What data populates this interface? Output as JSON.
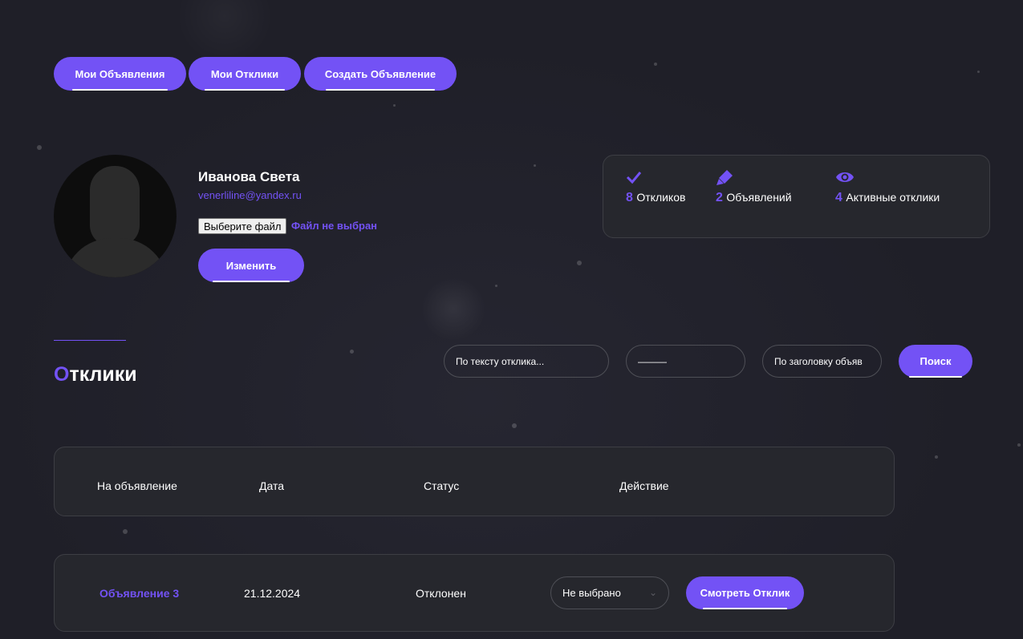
{
  "nav": {
    "my_ads": "Мои Объявления",
    "my_responses": "Мои Отклики",
    "create_ad": "Создать Объявление"
  },
  "profile": {
    "name": "Иванова Света",
    "email": "venerliline@yandex.ru",
    "file_button": "Выберите файл",
    "file_status": "Файл не выбран",
    "edit_button": "Изменить"
  },
  "stats": [
    {
      "icon": "check-icon",
      "value": "8",
      "label": "Откликов"
    },
    {
      "icon": "marker-icon",
      "value": "2",
      "label": "Объявлений"
    },
    {
      "icon": "eye-icon",
      "value": "4",
      "label": "Активные отклики"
    }
  ],
  "section": {
    "title_first": "О",
    "title_rest": "тклики"
  },
  "filters": {
    "text_placeholder": "По тексту отклика...",
    "date_value": "———",
    "title_placeholder": "По заголовку объяв",
    "search_button": "Поиск"
  },
  "table": {
    "headers": [
      "На объявление",
      "Дата",
      "Статус",
      "Действие"
    ],
    "rows": [
      {
        "ad": "Объявление 3",
        "date": "21.12.2024",
        "status": "Отклонен",
        "action_select": "Не выбрано",
        "view_button": "Смотреть Отклик"
      }
    ]
  },
  "colors": {
    "accent": "#7352f5",
    "background": "#1f1f28",
    "panel": "#26272d"
  }
}
